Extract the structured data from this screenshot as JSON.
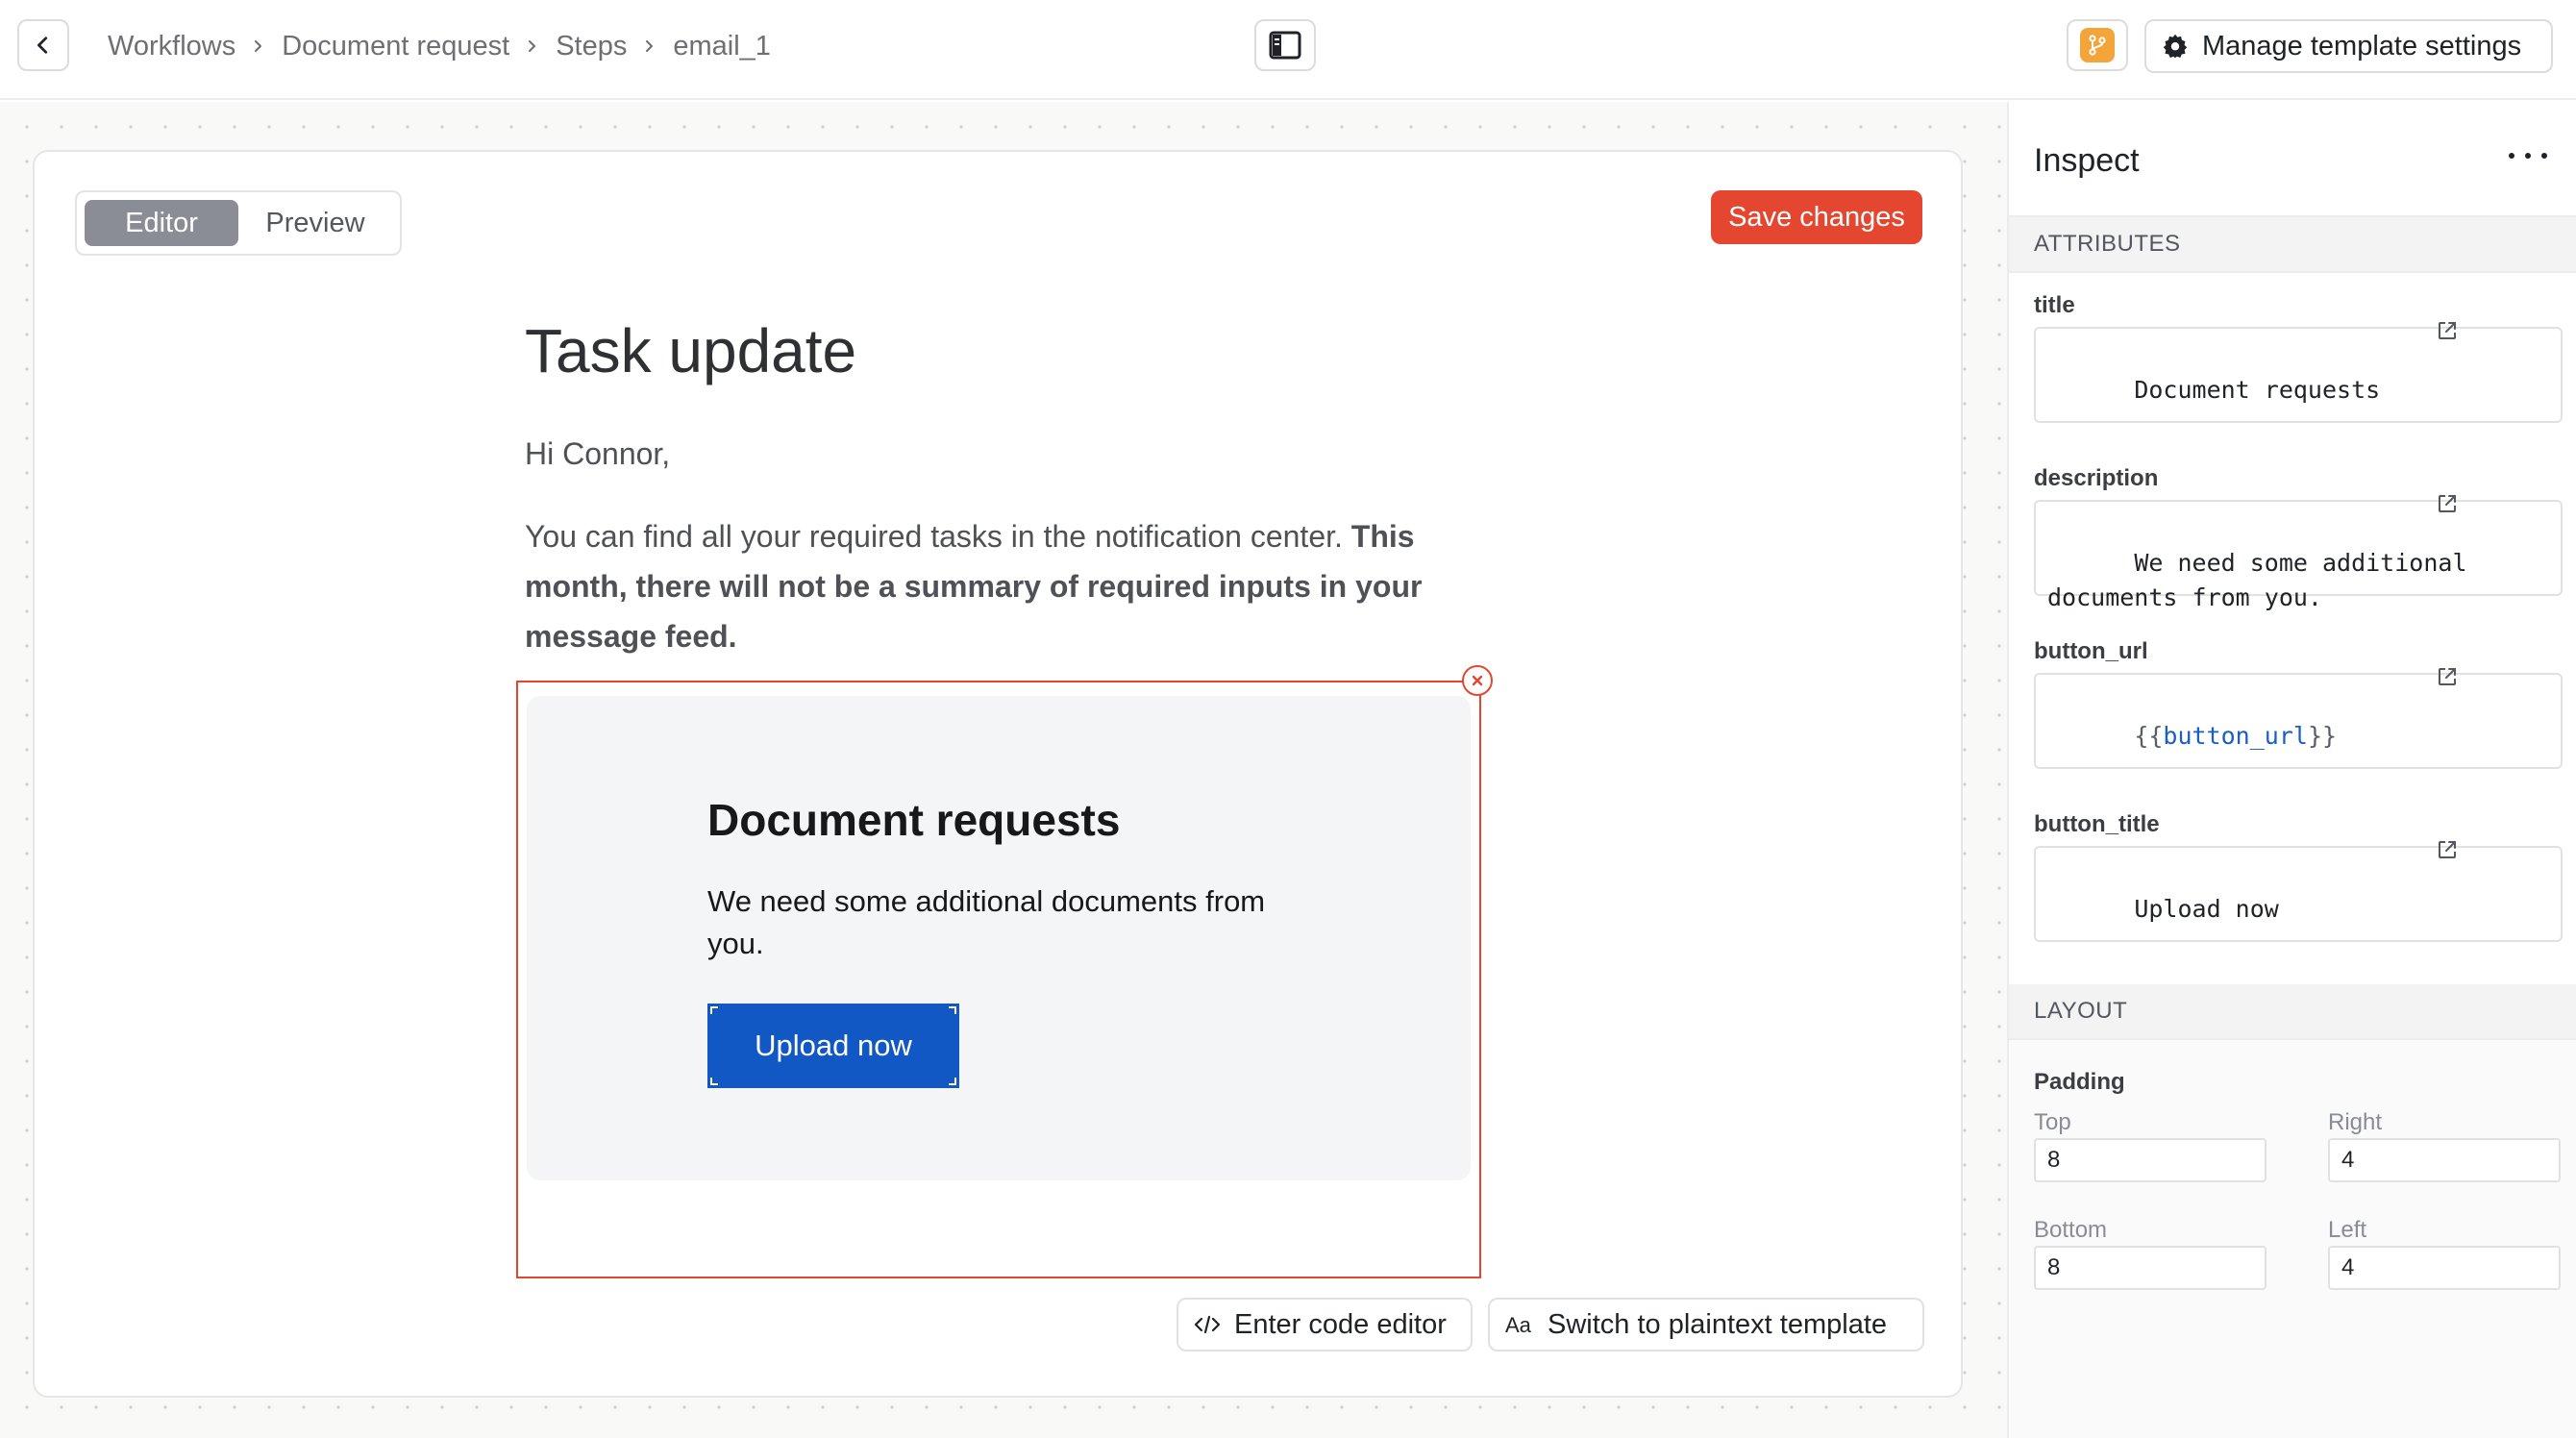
{
  "topbar": {
    "breadcrumb": [
      "Workflows",
      "Document request",
      "Steps",
      "email_1"
    ],
    "manage_settings_label": "Manage template settings"
  },
  "editor": {
    "tabs": {
      "editor": "Editor",
      "preview": "Preview",
      "active": "Editor"
    },
    "save_label": "Save changes",
    "email_title": "Task update",
    "greeting": "Hi Connor,",
    "body_plain": "You can find all your required tasks in the notification center.",
    "body_bold": "This month, there will not be a summary of required inputs in your message feed.",
    "block": {
      "title": "Document requests",
      "description": "We need some additional documents from you.",
      "button_label": "Upload now"
    },
    "code_editor_label": "Enter code editor",
    "plaintext_label": "Switch to plaintext template"
  },
  "inspector": {
    "title": "Inspect",
    "attributes_heading": "ATTRIBUTES",
    "attributes": {
      "title": {
        "label": "title",
        "value": "Document requests"
      },
      "description": {
        "label": "description",
        "value": "We need some additional documents from you."
      },
      "button_url": {
        "label": "button_url",
        "open": "{{",
        "var": "button_url",
        "close": "}}"
      },
      "button_title": {
        "label": "button_title",
        "value": "Upload now"
      }
    },
    "layout_heading": "LAYOUT",
    "padding": {
      "label": "Padding",
      "top_label": "Top",
      "top": "8",
      "right_label": "Right",
      "right": "4",
      "bottom_label": "Bottom",
      "bottom": "8",
      "left_label": "Left",
      "left": "4"
    }
  },
  "colors": {
    "accent_red": "#e5462f",
    "button_blue": "#1258c4",
    "branch_orange": "#f4a53a"
  },
  "icons": [
    "chevron-left-icon",
    "chevron-right-icon",
    "sidebar-icon",
    "branch-icon",
    "gear-icon",
    "close-circle-icon",
    "code-icon",
    "text-icon",
    "external-link-icon",
    "more-icon"
  ]
}
